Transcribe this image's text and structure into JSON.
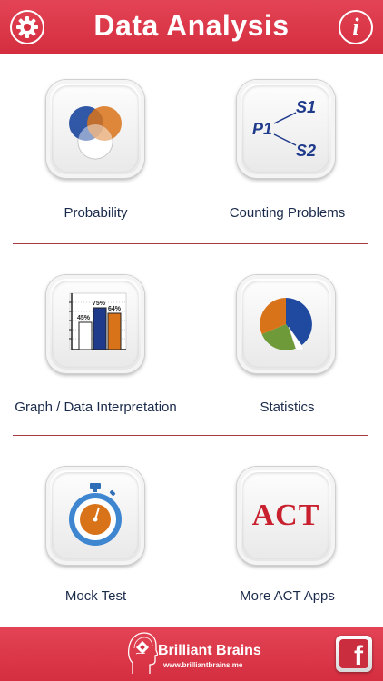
{
  "header": {
    "title": "Data Analysis",
    "settings_icon": "gear-icon",
    "info_label": "i"
  },
  "tiles": [
    {
      "label": "Probability",
      "icon": "venn-diagram-icon"
    },
    {
      "label": "Counting Problems",
      "icon": "tree-diagram-icon",
      "icon_text": {
        "root": "P1",
        "branch_top": "S1",
        "branch_bottom": "S2"
      }
    },
    {
      "label": "Graph / Data Interpretation",
      "icon": "bar-chart-icon",
      "icon_text": {
        "bar1": "45%",
        "bar2": "75%",
        "bar3": "64%"
      }
    },
    {
      "label": "Statistics",
      "icon": "pie-chart-icon"
    },
    {
      "label": "Mock Test",
      "icon": "stopwatch-icon"
    },
    {
      "label": "More ACT Apps",
      "icon": "act-logo-icon",
      "icon_text": "ACT"
    }
  ],
  "footer": {
    "brand_name": "Brilliant Brains",
    "brand_url": "www.brilliantbrains.me",
    "facebook_icon": "facebook-icon",
    "facebook_label": "f"
  },
  "colors": {
    "header_red": "#d42e40",
    "divider": "#a83a3e",
    "label_text": "#1a2a4a",
    "blue": "#1f4aa0",
    "orange": "#d9731a",
    "green": "#6e9a3a"
  }
}
